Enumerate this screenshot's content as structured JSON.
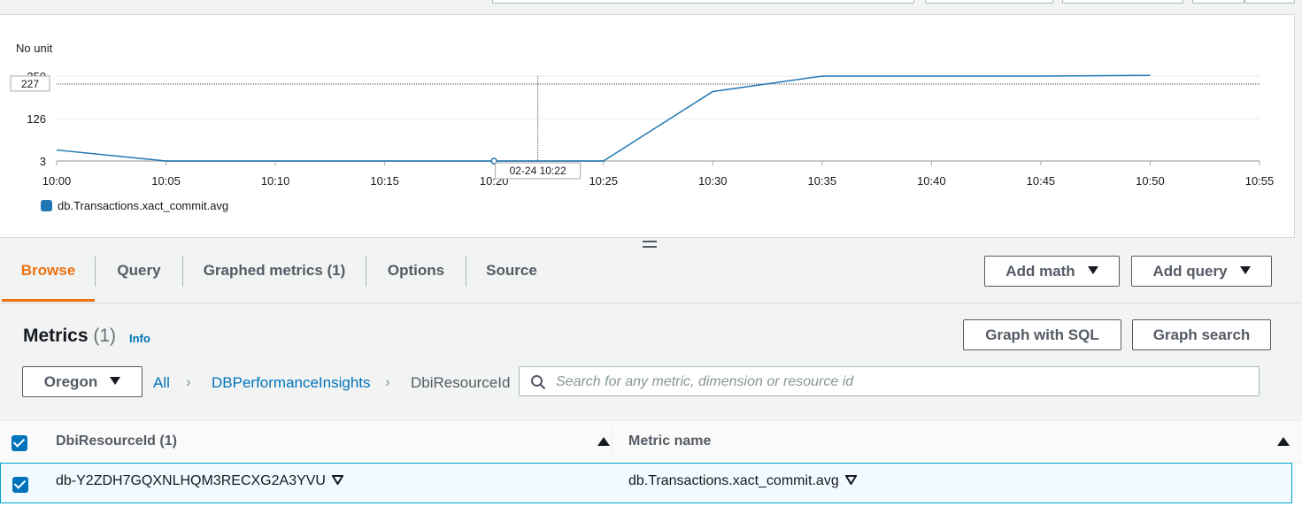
{
  "chart_data": {
    "type": "line",
    "unit_label": "No unit",
    "x_ticks": [
      "10:00",
      "10:05",
      "10:10",
      "10:15",
      "10:20",
      "10:25",
      "10:30",
      "10:35",
      "10:40",
      "10:45",
      "10:50",
      "10:55"
    ],
    "y_ticks": [
      3,
      126,
      250
    ],
    "ylim": [
      3,
      250
    ],
    "series": [
      {
        "name": "db.Transactions.xact_commit.avg",
        "color": "#1f77b4",
        "x": [
          "10:00",
          "10:05",
          "10:10",
          "10:15",
          "10:20",
          "10:25",
          "10:30",
          "10:35",
          "10:40",
          "10:45",
          "10:50"
        ],
        "values": [
          35,
          3,
          3,
          3,
          3,
          3,
          205,
          250,
          250,
          250,
          252
        ]
      }
    ],
    "cursor": {
      "y_value": "227",
      "time_label": "02-24 10:22"
    },
    "grid": true,
    "legend_position": "bottom-left"
  },
  "tabs": [
    {
      "label": "Browse",
      "active": true
    },
    {
      "label": "Query"
    },
    {
      "label": "Graphed metrics (1)"
    },
    {
      "label": "Options"
    },
    {
      "label": "Source"
    }
  ],
  "buttons": {
    "add_math": "Add math",
    "add_query": "Add query",
    "graph_with_sql": "Graph with SQL",
    "graph_search": "Graph search"
  },
  "metrics": {
    "title": "Metrics",
    "count": "(1)",
    "info": "Info"
  },
  "region": "Oregon",
  "breadcrumb": {
    "all": "All",
    "namespace": "DBPerformanceInsights",
    "current": "DbiResourceId"
  },
  "search": {
    "placeholder": "Search for any metric, dimension or resource id"
  },
  "table": {
    "headers": [
      "DbiResourceId  (1)",
      "Metric name"
    ],
    "rows": [
      {
        "resource_id": "db-Y2ZDH7GQXNLHQM3RECXG2A3YVU",
        "metric_name": "db.Transactions.xact_commit.avg"
      }
    ]
  }
}
